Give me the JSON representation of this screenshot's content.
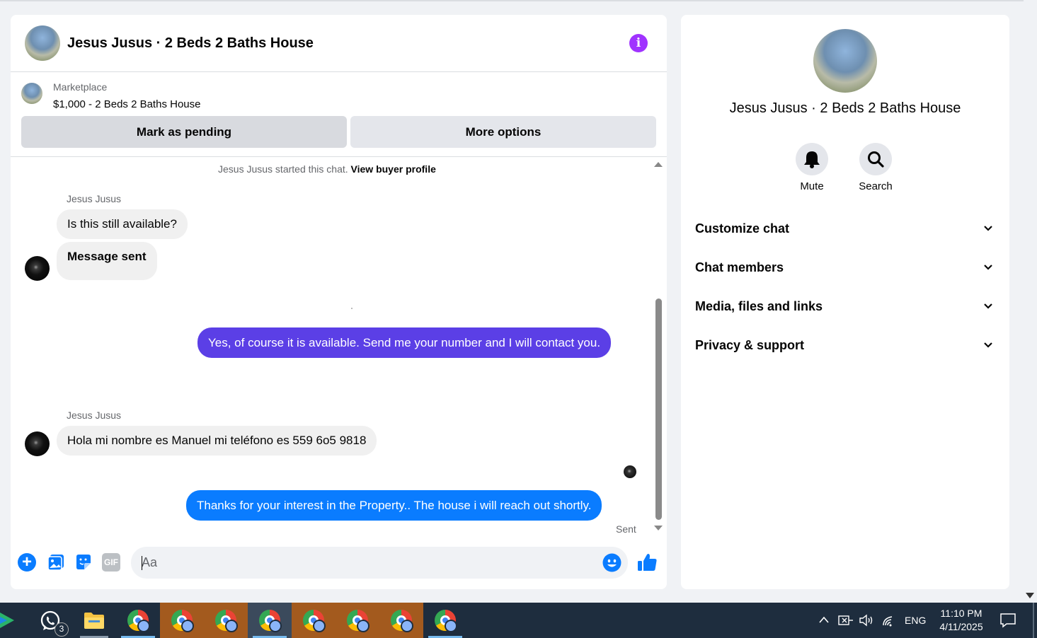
{
  "chat": {
    "title": "Jesus Jusus · 2 Beds 2 Baths House",
    "marketplace_label": "Marketplace",
    "listing": "$1,000 - 2 Beds 2 Baths House",
    "mark_pending": "Mark as pending",
    "more_options": "More options",
    "started_text": "Jesus Jusus started this chat.",
    "view_buyer": "View buyer profile",
    "messages": [
      {
        "sender": "Jesus Jusus",
        "text": "Is this still available?"
      },
      {
        "text": "Message sent"
      },
      {
        "text": "Yes, of course it is available. Send me your number and I will contact you.",
        "color": "#5b3fe6"
      },
      {
        "sender": "Jesus Jusus",
        "text": "Hola mi nombre es  Manuel  mi teléfono es 559 6o5 9818"
      },
      {
        "text": "Thanks for your interest in the Property.. The house i will reach  out shortly.",
        "color": "#0a7cff"
      }
    ],
    "sent_status": "Sent",
    "composer_placeholder": "Aa",
    "gif_label": "GIF"
  },
  "panel": {
    "title": "Jesus Jusus · 2 Beds 2 Baths House",
    "mute_label": "Mute",
    "search_label": "Search",
    "sections": [
      "Customize chat",
      "Chat members",
      "Media, files and links",
      "Privacy & support"
    ]
  },
  "taskbar": {
    "whatsapp_badge": "3",
    "language": "ENG",
    "time": "11:10 PM",
    "date": "4/11/2025"
  },
  "colors": {
    "accent": "#0a7cff",
    "purple_bubble": "#5b3fe6",
    "info_icon": "#a033ff"
  }
}
